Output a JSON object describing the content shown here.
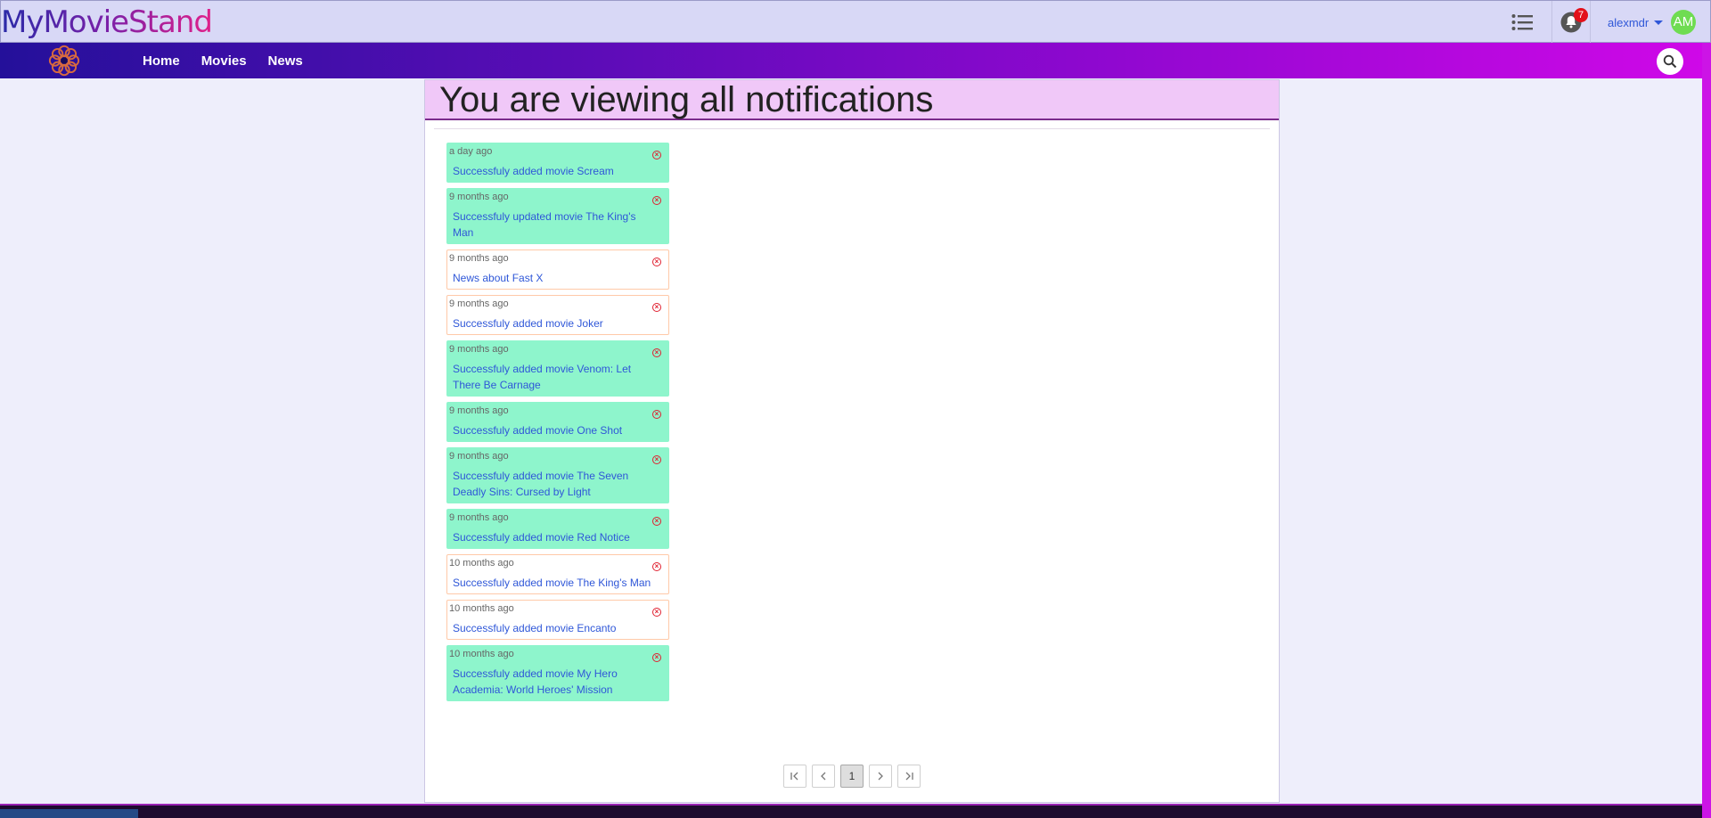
{
  "header": {
    "logo_text": "MyMovieStand",
    "notifications_count": "7",
    "username": "alexmdr",
    "avatar_initials": "AM"
  },
  "nav": {
    "links": [
      "Home",
      "Movies",
      "News"
    ]
  },
  "page": {
    "title": "You are viewing all notifications"
  },
  "notifications": [
    {
      "time": "a day ago",
      "text": "Successfuly added movie Scream",
      "unread": true
    },
    {
      "time": "9 months ago",
      "text": "Successfuly updated movie The King's Man",
      "unread": true
    },
    {
      "time": "9 months ago",
      "text": "News about Fast X",
      "unread": false
    },
    {
      "time": "9 months ago",
      "text": "Successfuly added movie Joker",
      "unread": false
    },
    {
      "time": "9 months ago",
      "text": "Successfuly added movie Venom: Let There Be Carnage",
      "unread": true
    },
    {
      "time": "9 months ago",
      "text": "Successfuly added movie One Shot",
      "unread": true
    },
    {
      "time": "9 months ago",
      "text": "Successfuly added movie The Seven Deadly Sins: Cursed by Light",
      "unread": true
    },
    {
      "time": "9 months ago",
      "text": "Successfuly added movie Red Notice",
      "unread": true
    },
    {
      "time": "10 months ago",
      "text": "Successfuly added movie The King's Man",
      "unread": false
    },
    {
      "time": "10 months ago",
      "text": "Successfuly added movie Encanto",
      "unread": false
    },
    {
      "time": "10 months ago",
      "text": "Successfuly added movie My Hero Academia: World Heroes' Mission",
      "unread": true
    }
  ],
  "pagination": {
    "current_page": "1",
    "first_icon": "first-page-icon",
    "prev_icon": "chevron-left-icon",
    "next_icon": "chevron-right-icon",
    "last_icon": "last-page-icon"
  },
  "colors": {
    "unread_bg": "#8ef5cc",
    "read_border": "#ffc9a8",
    "link": "#2f57d8",
    "title_bg": "#f0c8f8"
  }
}
